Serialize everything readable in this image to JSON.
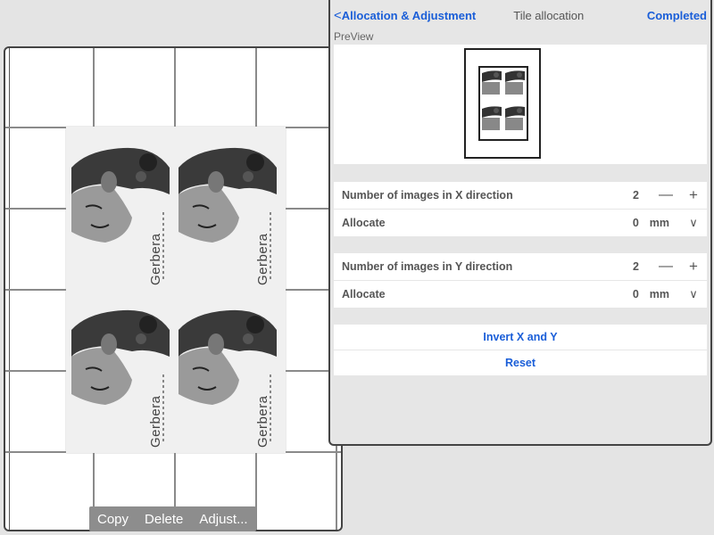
{
  "header": {
    "back_label": "Allocation & Adjustment",
    "title": "Tile allocation",
    "completed_label": "Completed"
  },
  "preview": {
    "label": "PreView"
  },
  "x_direction": {
    "label": "Number of images in X direction",
    "value": "2",
    "allocate_label": "Allocate",
    "allocate_value": "0",
    "allocate_unit": "mm"
  },
  "y_direction": {
    "label": "Number of images in Y direction",
    "value": "2",
    "allocate_label": "Allocate",
    "allocate_value": "0",
    "allocate_unit": "mm"
  },
  "actions": {
    "invert_label": "Invert X and Y",
    "reset_label": "Reset"
  },
  "canvas": {
    "tile_text": "Gerbera"
  },
  "context_menu": {
    "copy": "Copy",
    "delete": "Delete",
    "adjust": "Adjust..."
  },
  "colors": {
    "accent": "#1a5ed8",
    "panel_bg": "#e6e6e6"
  },
  "icons": {
    "back": "chevron-left-icon",
    "minus": "minus-icon",
    "plus": "plus-icon",
    "dropdown": "chevron-down-icon"
  }
}
